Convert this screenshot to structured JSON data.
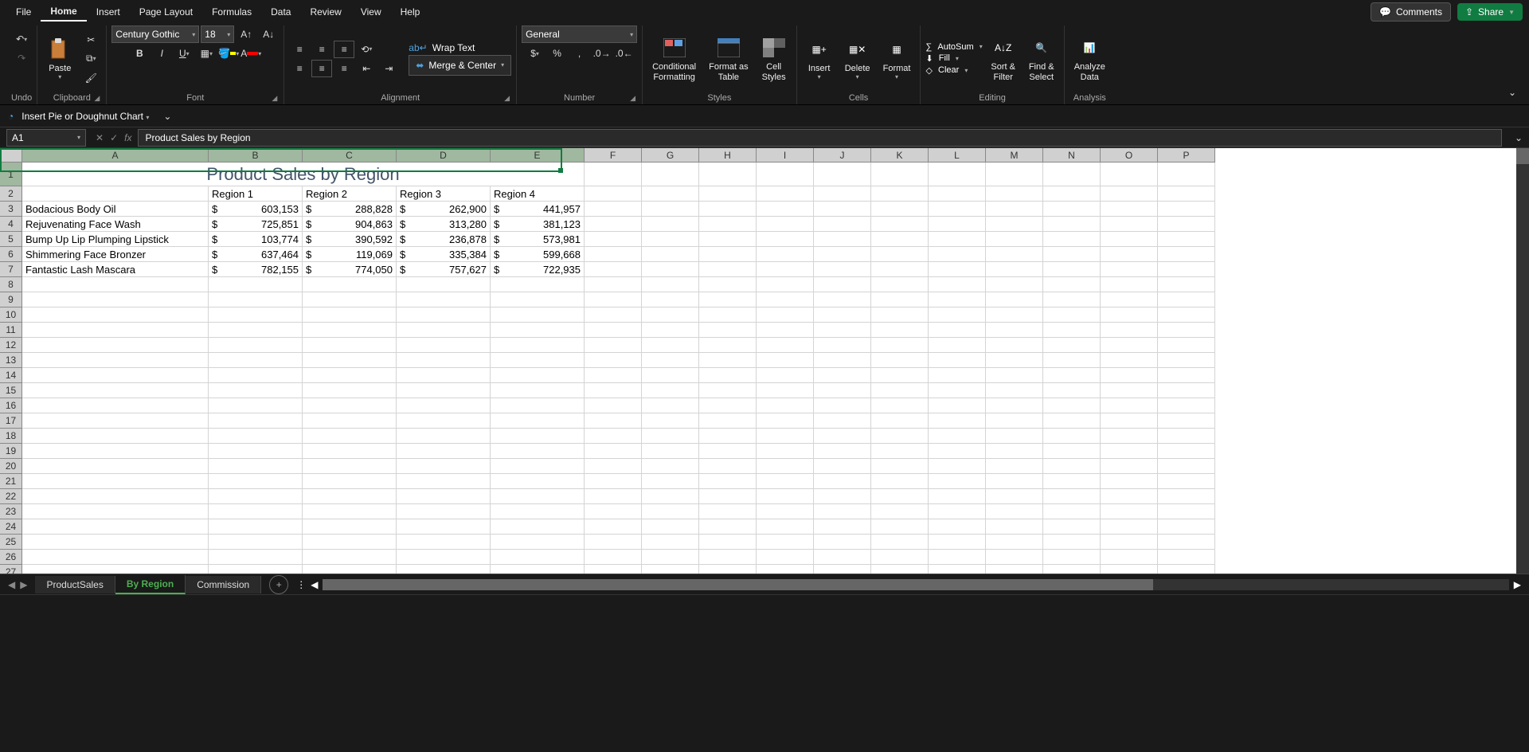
{
  "menu": {
    "tabs": [
      "File",
      "Home",
      "Insert",
      "Page Layout",
      "Formulas",
      "Data",
      "Review",
      "View",
      "Help"
    ],
    "active": 1,
    "comments": "Comments",
    "share": "Share"
  },
  "ribbon": {
    "undo_label": "Undo",
    "clipboard": {
      "paste": "Paste",
      "label": "Clipboard"
    },
    "font": {
      "name": "Century Gothic",
      "size": "18",
      "label": "Font"
    },
    "alignment": {
      "wrap": "Wrap Text",
      "merge": "Merge & Center",
      "label": "Alignment"
    },
    "number": {
      "format": "General",
      "label": "Number"
    },
    "styles": {
      "cond": "Conditional\nFormatting",
      "table": "Format as\nTable",
      "cell": "Cell\nStyles",
      "label": "Styles"
    },
    "cells": {
      "insert": "Insert",
      "delete": "Delete",
      "format": "Format",
      "label": "Cells"
    },
    "editing": {
      "autosum": "AutoSum",
      "fill": "Fill",
      "clear": "Clear",
      "sort": "Sort &\nFilter",
      "find": "Find &\nSelect",
      "label": "Editing"
    },
    "analysis": {
      "analyze": "Analyze\nData",
      "label": "Analysis"
    }
  },
  "qat": {
    "chart": "Insert Pie or Doughnut Chart"
  },
  "fbar": {
    "name": "A1",
    "formula": "Product Sales by Region"
  },
  "sheet": {
    "title": "Product Sales by Region",
    "regions": [
      "Region 1",
      "Region 2",
      "Region 3",
      "Region 4"
    ],
    "rows": [
      {
        "product": "Bodacious Body Oil",
        "vals": [
          "603,153",
          "288,828",
          "262,900",
          "441,957"
        ]
      },
      {
        "product": "Rejuvenating Face Wash",
        "vals": [
          "725,851",
          "904,863",
          "313,280",
          "381,123"
        ]
      },
      {
        "product": "Bump Up Lip Plumping Lipstick",
        "vals": [
          "103,774",
          "390,592",
          "236,878",
          "573,981"
        ]
      },
      {
        "product": "Shimmering Face Bronzer",
        "vals": [
          "637,464",
          "119,069",
          "335,384",
          "599,668"
        ]
      },
      {
        "product": "Fantastic Lash Mascara",
        "vals": [
          "782,155",
          "774,050",
          "757,627",
          "722,935"
        ]
      }
    ],
    "cols": [
      "A",
      "B",
      "C",
      "D",
      "E",
      "F",
      "G",
      "H",
      "I",
      "J",
      "K",
      "L",
      "M",
      "N",
      "O",
      "P"
    ]
  },
  "tabs": {
    "sheets": [
      "ProductSales",
      "By Region",
      "Commission"
    ],
    "active": 1
  },
  "chart_data": {
    "type": "table",
    "title": "Product Sales by Region",
    "categories": [
      "Region 1",
      "Region 2",
      "Region 3",
      "Region 4"
    ],
    "series": [
      {
        "name": "Bodacious Body Oil",
        "values": [
          603153,
          288828,
          262900,
          441957
        ]
      },
      {
        "name": "Rejuvenating Face Wash",
        "values": [
          725851,
          904863,
          313280,
          381123
        ]
      },
      {
        "name": "Bump Up Lip Plumping Lipstick",
        "values": [
          103774,
          390592,
          236878,
          573981
        ]
      },
      {
        "name": "Shimmering Face Bronzer",
        "values": [
          637464,
          119069,
          335384,
          599668
        ]
      },
      {
        "name": "Fantastic Lash Mascara",
        "values": [
          782155,
          774050,
          757627,
          722935
        ]
      }
    ]
  }
}
